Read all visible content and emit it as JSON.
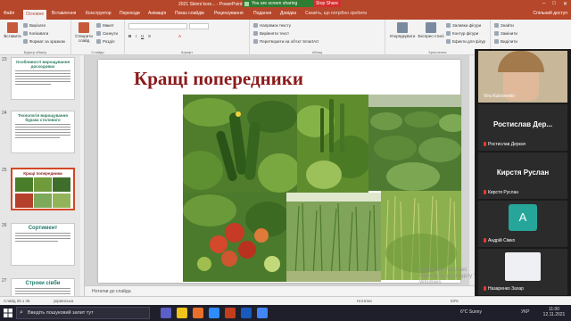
{
  "window": {
    "title": "2021 Skinni kore... - PowerPoint ... ате продукт",
    "minimize": "–",
    "maximize": "□",
    "close": "✕"
  },
  "share": {
    "status": "You are screen sharing",
    "stop_label": "Stop Share"
  },
  "tabs": [
    "Файл",
    "Основне",
    "Вставлення",
    "Конструктор",
    "Переходи",
    "Анімація",
    "Показ слайдів",
    "Рецензування",
    "Подання",
    "Довідка",
    "Скажіть, що потрібно зробити"
  ],
  "active_tab": "Основне",
  "share_button": "Спільний доступ",
  "ribbon": {
    "clipboard": {
      "paste": "Вставити",
      "cut": "Вирізати",
      "copy": "Копіювати",
      "format": "Формат за зразком",
      "label": "Буфер обміну"
    },
    "slides": {
      "new_slide": "Створити слайд",
      "layout": "Макет",
      "reset": "Скинути",
      "section": "Розділ",
      "label": "Слайди"
    },
    "font": {
      "label": "Шрифт"
    },
    "paragraph": {
      "text_dir": "Напрямок тексту",
      "align_text": "Вирівняти текст",
      "smartart": "Перетворити на об'єкт SmartArt",
      "label": "Абзац"
    },
    "drawing": {
      "arrange": "Упорядкувати",
      "quick_styles": "Експрес-стилі",
      "fill": "Заливка фігури",
      "outline": "Контур фігури",
      "effects": "Ефекти для фігур",
      "label": "Креслення"
    },
    "editing": {
      "find": "Знайти",
      "replace": "Замінити",
      "select": "Виділити",
      "label": "Редагування"
    }
  },
  "thumbnails": [
    {
      "num": "23",
      "title": "Особливості вирощування досходових"
    },
    {
      "num": "24",
      "title": "Технологія вирощування бурака столового"
    },
    {
      "num": "25",
      "title": "Кращі попередники"
    },
    {
      "num": "26",
      "title": "Сортимент"
    },
    {
      "num": "27",
      "title": "Строки сівби"
    }
  ],
  "slide": {
    "title": "Кращі попередники"
  },
  "notes_placeholder": "Нотатки до слайда",
  "status": {
    "slide_info": "Слайд 25 з 45",
    "language": "українська",
    "notes": "Нотатки",
    "zoom": "63%"
  },
  "participants": [
    {
      "name": "Vira Kukovenko",
      "display": "",
      "type": "video",
      "muted": false
    },
    {
      "name": "Ростислав Деркач",
      "display": "Ростислав Дер...",
      "type": "name",
      "muted": true
    },
    {
      "name": "Кирстя Руслан",
      "display": "Кирстя Руслан",
      "type": "name",
      "muted": true
    },
    {
      "name": "Андрій Сімко",
      "display": "A",
      "type": "avatar",
      "muted": true
    },
    {
      "name": "Назаренко Захар",
      "display": "",
      "type": "blank",
      "muted": true
    }
  ],
  "watermark": [
    "Активація Windows",
    "Перейдіть до розділу \"Настройки\", щоб активувати",
    "Windows."
  ],
  "taskbar": {
    "search_placeholder": "Введіть пошуковий запит тут",
    "weather": "6°C Sunny",
    "language": "УКР",
    "time": "11:00",
    "date": "12.11.2021"
  },
  "colors": {
    "accent": "#b7472a",
    "title_red": "#8b1a1a"
  }
}
